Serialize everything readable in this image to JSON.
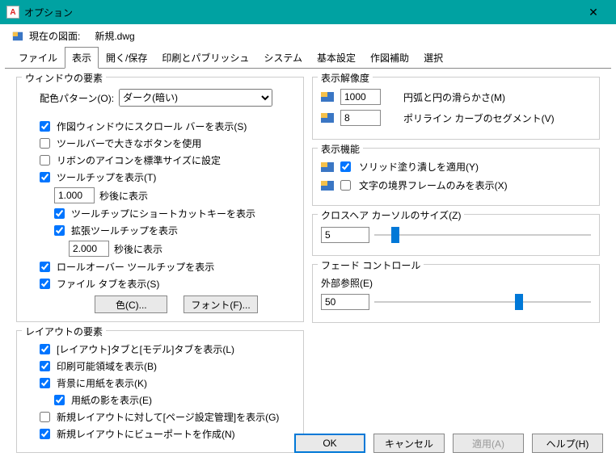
{
  "window": {
    "title": "オプション"
  },
  "drawing": {
    "label": "現在の図面:",
    "name": "新規.dwg"
  },
  "tabs": {
    "file": "ファイル",
    "display": "表示",
    "opensave": "開く/保存",
    "print": "印刷とパブリッシュ",
    "system": "システム",
    "basic": "基本設定",
    "drafting": "作図補助",
    "selection": "選択"
  },
  "windowElements": {
    "title": "ウィンドウの要素",
    "colorSchemeLabel": "配色パターン(O):",
    "colorSchemeValue": "ダーク(暗い)",
    "scrollbar": "作図ウィンドウにスクロール バーを表示(S)",
    "largeButtons": "ツールバーで大きなボタンを使用",
    "ribbonIcons": "リボンのアイコンを標準サイズに設定",
    "tooltip": "ツールチップを表示(T)",
    "tooltipDelay": "1.000",
    "tooltipDelayLabel": "秒後に表示",
    "shortcut": "ツールチップにショートカットキーを表示",
    "extTooltip": "拡張ツールチップを表示",
    "extDelay": "2.000",
    "extDelayLabel": "秒後に表示",
    "rollover": "ロールオーバー ツールチップを表示",
    "fileTabs": "ファイル タブを表示(S)",
    "colorBtn": "色(C)...",
    "fontBtn": "フォント(F)..."
  },
  "layoutElements": {
    "title": "レイアウトの要素",
    "layoutModel": "[レイアウト]タブと[モデル]タブを表示(L)",
    "printable": "印刷可能領域を表示(B)",
    "paper": "背景に用紙を表示(K)",
    "shadow": "用紙の影を表示(E)",
    "pageSetup": "新規レイアウトに対して[ページ設定管理]を表示(G)",
    "viewport": "新規レイアウトにビューポートを作成(N)"
  },
  "resolution": {
    "title": "表示解像度",
    "arcVal": "1000",
    "arcLabel": "円弧と円の滑らかさ(M)",
    "polyVal": "8",
    "polyLabel": "ポリライン カーブのセグメント(V)"
  },
  "displayFunc": {
    "title": "表示機能",
    "solid": "ソリッド塗り潰しを適用(Y)",
    "textFrame": "文字の境界フレームのみを表示(X)"
  },
  "crosshair": {
    "title": "クロスヘア カーソルのサイズ(Z)",
    "val": "5"
  },
  "fade": {
    "title": "フェード コントロール",
    "xrefLabel": "外部参照(E)",
    "xrefVal": "50"
  },
  "buttons": {
    "ok": "OK",
    "cancel": "キャンセル",
    "apply": "適用(A)",
    "help": "ヘルプ(H)"
  }
}
